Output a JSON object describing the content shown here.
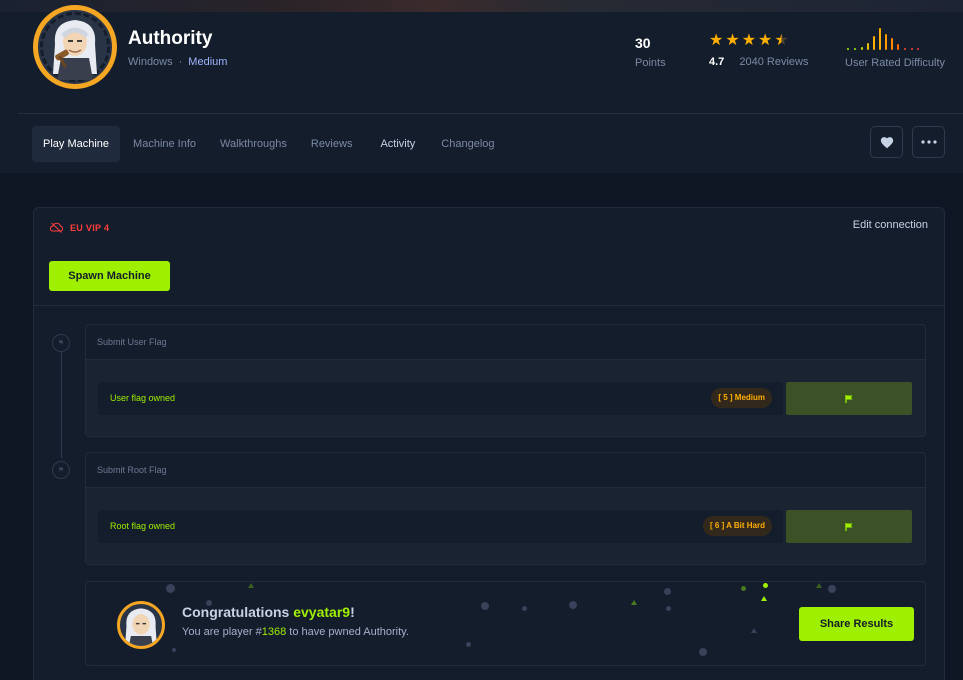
{
  "machine": {
    "name": "Authority",
    "os": "Windows",
    "separator": "·",
    "difficulty": "Medium",
    "points": "30",
    "points_label": "Points",
    "rating": "4.7",
    "reviews": "2040 Reviews",
    "stars_rating": 4.5,
    "user_difficulty_label": "User Rated Difficulty"
  },
  "tabs": [
    {
      "label": "Play Machine"
    },
    {
      "label": "Machine Info"
    },
    {
      "label": "Walkthroughs"
    },
    {
      "label": "Reviews"
    },
    {
      "label": "Activity"
    },
    {
      "label": "Changelog"
    }
  ],
  "actions": {
    "favorite_icon": "heart-icon",
    "more_icon": "more-dots-icon"
  },
  "connection": {
    "server": "EU VIP 4",
    "status_icon": "cloud-off-icon",
    "edit_label": "Edit connection",
    "spawn_label": "Spawn Machine"
  },
  "flags": [
    {
      "heading": "Submit User Flag",
      "status": "User flag owned",
      "badge": "[ 5 ] Medium",
      "icon": "flag-icon"
    },
    {
      "heading": "Submit Root Flag",
      "status": "Root flag owned",
      "badge": "[ 6 ] A Bit Hard",
      "icon": "flag-icon"
    }
  ],
  "congrats": {
    "prefix": "Congratulations",
    "user": "evyatar9",
    "suffix": "!",
    "line_a": "You are player #",
    "player_number": "1368",
    "line_b": "to have pwned Authority.",
    "share_label": "Share Results"
  },
  "colors": {
    "accent": "#9fef00",
    "background": "#141d2b",
    "star": "#ffaf00",
    "server_red": "#ff3e3e",
    "ring": "#f5a623"
  }
}
